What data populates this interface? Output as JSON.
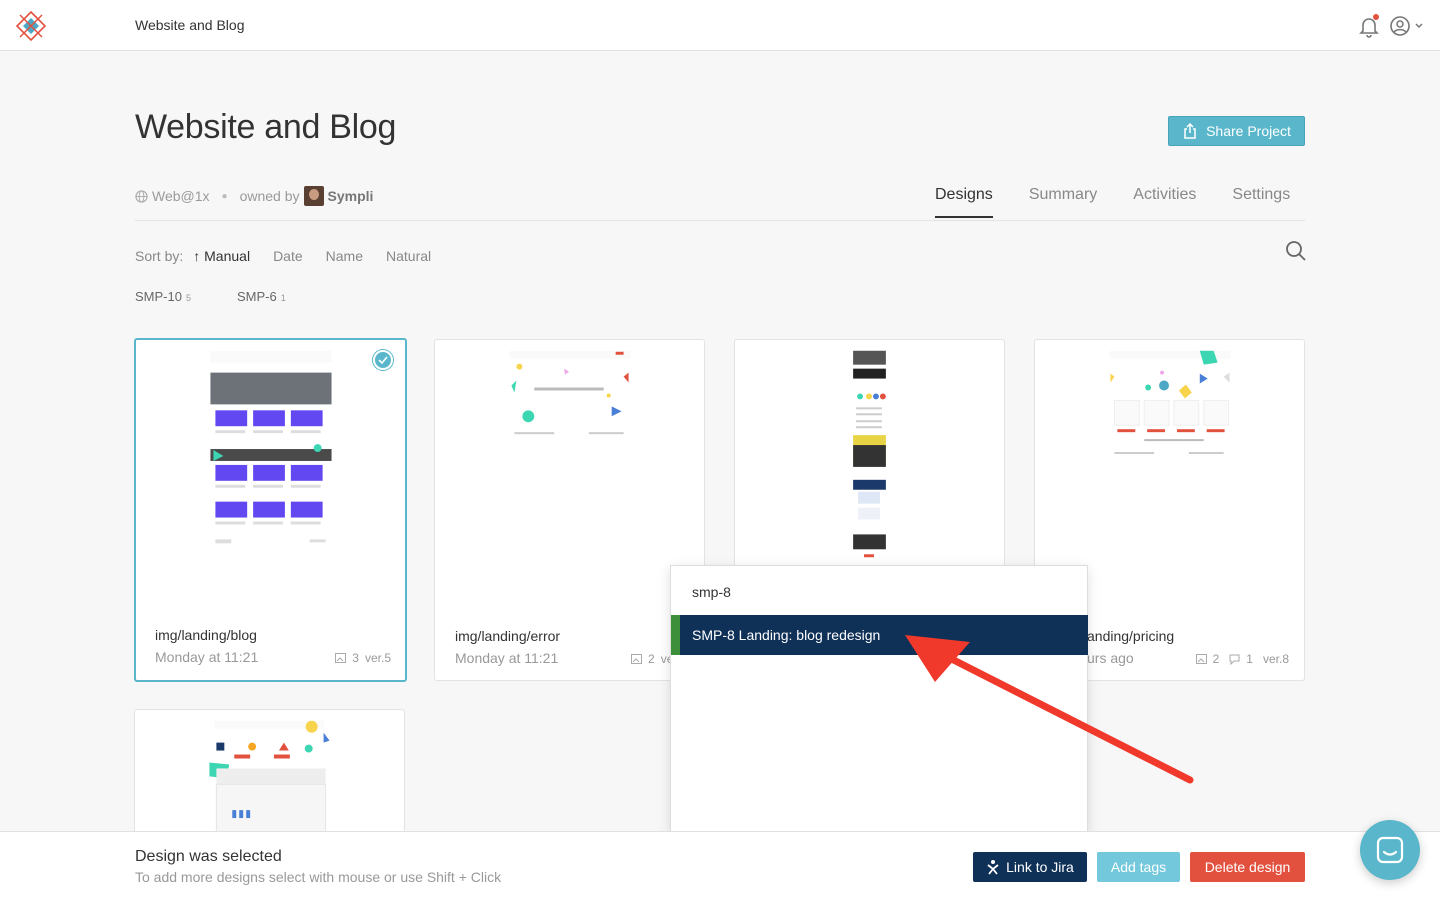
{
  "app": {
    "title": "Website and Blog"
  },
  "header": {
    "title": "Website and Blog",
    "share_label": "Share Project",
    "platform": "Web@1x",
    "owned_by": "owned by",
    "owner": "Sympli"
  },
  "tabs": [
    {
      "label": "Designs",
      "active": true
    },
    {
      "label": "Summary"
    },
    {
      "label": "Activities"
    },
    {
      "label": "Settings"
    }
  ],
  "sort": {
    "label": "Sort by:",
    "options": [
      "Manual",
      "Date",
      "Name",
      "Natural"
    ],
    "active_arrow": "↑"
  },
  "tags": [
    {
      "name": "SMP-10",
      "count": "5"
    },
    {
      "name": "SMP-6",
      "count": "1"
    }
  ],
  "cards": [
    {
      "name": "img/landing/blog",
      "time": "Monday at 11:21",
      "screens": "3",
      "comments": "",
      "version": "ver.5",
      "selected": true
    },
    {
      "name": "img/landing/error",
      "time": "Monday at 11:21",
      "screens": "2",
      "comments": "",
      "version": "ve"
    },
    {
      "name": "",
      "time": "",
      "screens": "",
      "comments": "",
      "version": ""
    },
    {
      "name": "anding/pricing",
      "time": "urs ago",
      "screens": "2",
      "comments": "1",
      "version": "ver.8"
    }
  ],
  "dropdown": {
    "query": "smp-8",
    "result": "SMP-8 Landing: blog redesign"
  },
  "actionbar": {
    "title": "Design was selected",
    "subtitle": "To add more designs select with mouse or use Shift + Click",
    "link_jira": "Link to Jira",
    "add_tags": "Add tags",
    "delete": "Delete design"
  },
  "colors": {
    "accent": "#5ab7cb",
    "navy": "#0f3057",
    "danger": "#e2503e",
    "jira_green": "#3d8f3a",
    "arrow": "#f0392b"
  }
}
